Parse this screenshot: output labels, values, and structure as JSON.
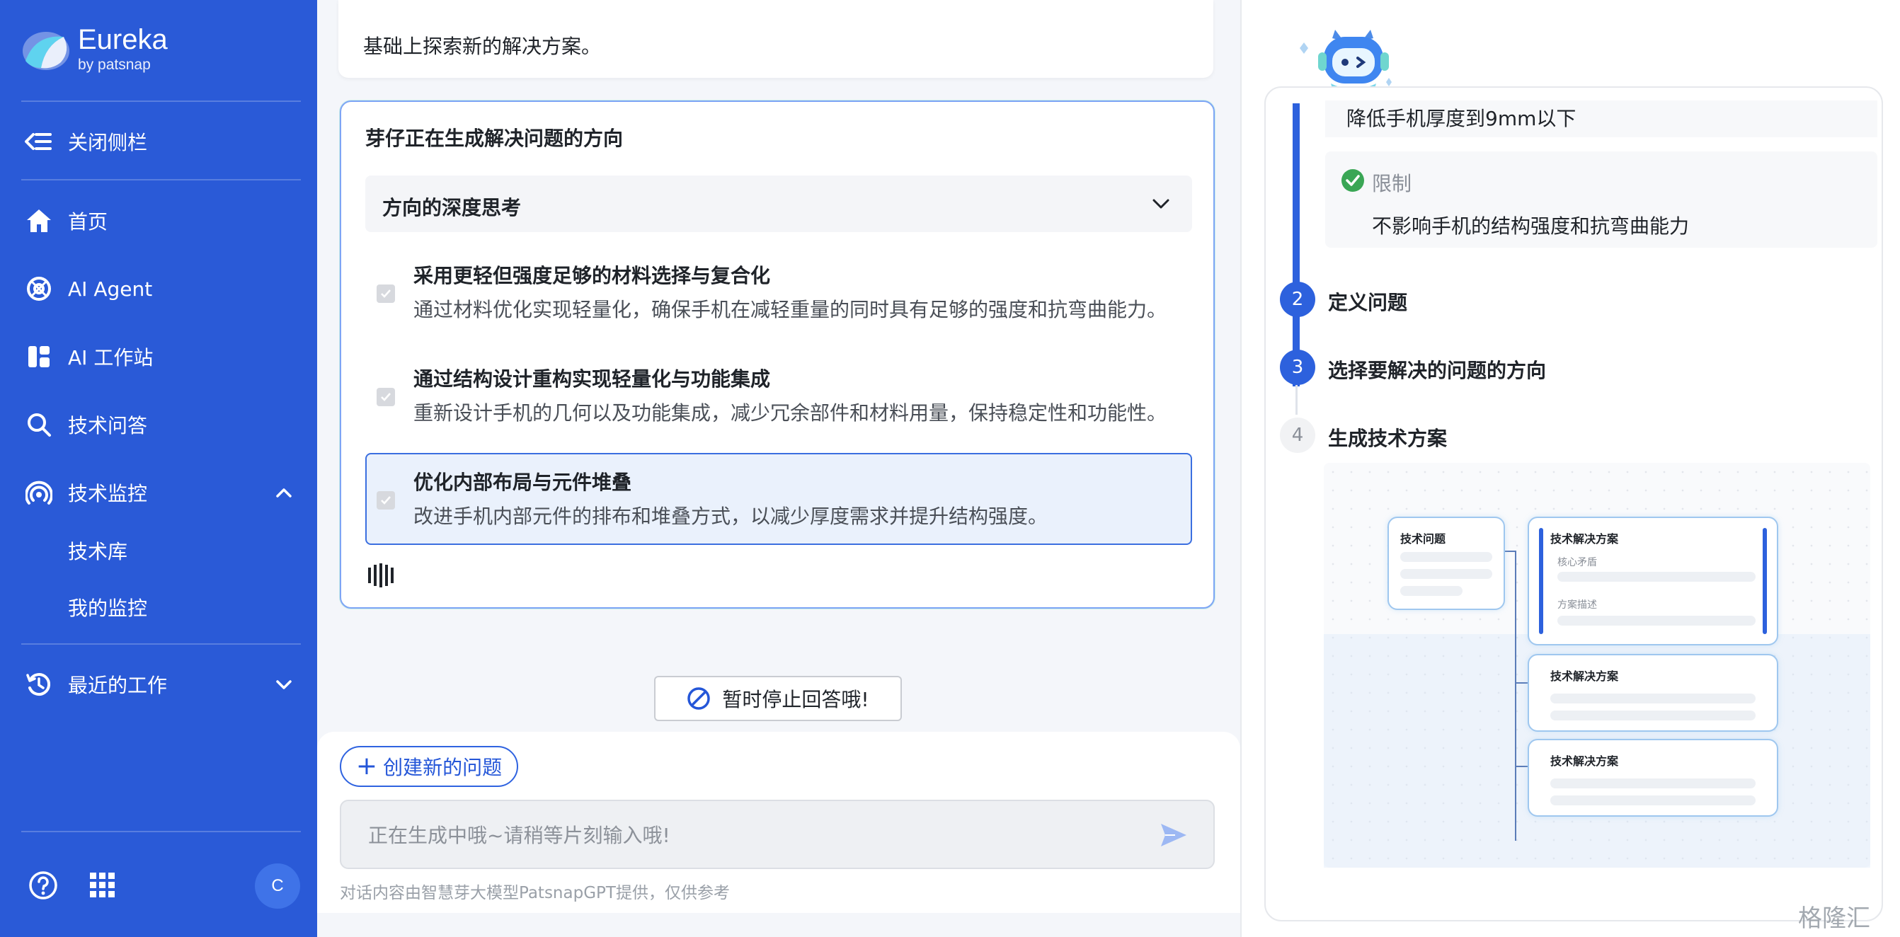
{
  "sidebar": {
    "brand_name": "Eureka",
    "brand_sub": "by patsnap",
    "collapse_label": "关闭侧栏",
    "nav": {
      "home": "首页",
      "agent": "AI Agent",
      "workstation": "AI 工作站",
      "qa": "技术问答",
      "monitor": "技术监控",
      "library": "技术库",
      "my_monitor": "我的监控",
      "recent": "最近的工作"
    },
    "avatar_letter": "C"
  },
  "main": {
    "top_text": "基础上探索新的解决方案。",
    "gen_title": "芽仔正在生成解决问题的方向",
    "depth_label": "方向的深度思考",
    "directions": [
      {
        "title": "采用更轻但强度足够的材料选择与复合化",
        "desc": "通过材料优化实现轻量化，确保手机在减轻重量的同时具有足够的强度和抗弯曲能力。",
        "selected": false
      },
      {
        "title": "通过结构设计重构实现轻量化与功能集成",
        "desc": "重新设计手机的几何以及功能集成，减少冗余部件和材料用量，保持稳定性和功能性。",
        "selected": false
      },
      {
        "title": "优化内部布局与元件堆叠",
        "desc": "改进手机内部元件的排布和堆叠方式，以减少厚度需求并提升结构强度。",
        "selected": true
      }
    ],
    "stop_label": "暂时停止回答哦!",
    "new_question_label": "创建新的问题",
    "input_placeholder": "正在生成中哦~请稍等片刻输入哦!",
    "disclaimer": "对话内容由智慧芽大模型PatsnapGPT提供，仅供参考"
  },
  "right": {
    "goal_text": "降低手机厚度到9mm以下",
    "limit_label": "限制",
    "limit_text": "不影响手机的结构强度和抗弯曲能力",
    "steps": [
      {
        "num": "2",
        "label": "定义问题",
        "active": true
      },
      {
        "num": "3",
        "label": "选择要解决的问题的方向",
        "active": true
      },
      {
        "num": "4",
        "label": "生成技术方案",
        "active": false
      }
    ],
    "preview": {
      "problem_card": "技术问题",
      "solution_card": "技术解决方案",
      "core_label": "核心矛盾",
      "desc_label": "方案描述"
    }
  },
  "watermark": "格隆汇",
  "colors": {
    "sidebar_bg": "#2a5ad7",
    "accent": "#2d61dd",
    "selected_bg": "#eaf1fc",
    "check_green": "#3aa655"
  }
}
